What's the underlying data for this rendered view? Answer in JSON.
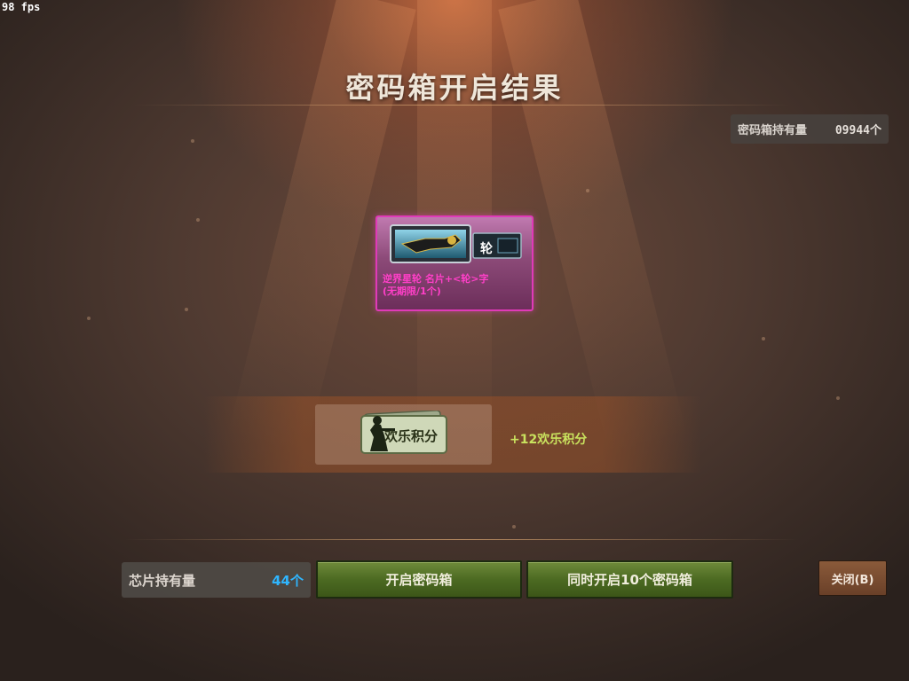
{
  "fps": "98 fps",
  "title": "密码箱开启结果",
  "box_holding": {
    "label": "密码箱持有量",
    "value": "09944个"
  },
  "reward": {
    "name_line1": "逆界星轮 名片+<轮>字",
    "name_line2": "(无期限/1个)",
    "tag_char": "轮",
    "rarity_color": "#e03ab8",
    "icon": "weapon-nameplate-icon"
  },
  "points": {
    "badge_text": "欢乐积分",
    "gain_text": "+12欢乐积分",
    "icon": "soldier-card-icon"
  },
  "chip_holding": {
    "label": "芯片持有量",
    "value": "44个"
  },
  "buttons": {
    "open_one": "开启密码箱",
    "open_ten": "同时开启10个密码箱",
    "close": "关闭(B)"
  },
  "colors": {
    "points_green": "#c9e25e",
    "chip_blue": "#2fb6ff"
  }
}
